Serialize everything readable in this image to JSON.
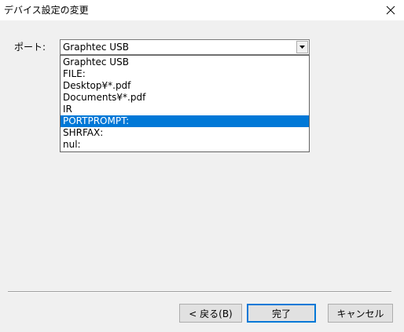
{
  "window": {
    "title": "デバイス設定の変更"
  },
  "port": {
    "label": "ポート:",
    "selected_value": "Graphtec USB",
    "options": [
      "Graphtec USB",
      "FILE:",
      "Desktop¥*.pdf",
      "Documents¥*.pdf",
      "IR",
      "PORTPROMPT:",
      "SHRFAX:",
      "nul:"
    ],
    "highlighted_index": 5
  },
  "buttons": {
    "back": "< 戻る(B)",
    "finish": "完了",
    "cancel": "キャンセル"
  },
  "colors": {
    "highlight": "#0078d7",
    "background": "#f0f0f0"
  },
  "icons": {
    "close": "close-icon",
    "dropdown": "chevron-down-icon"
  }
}
